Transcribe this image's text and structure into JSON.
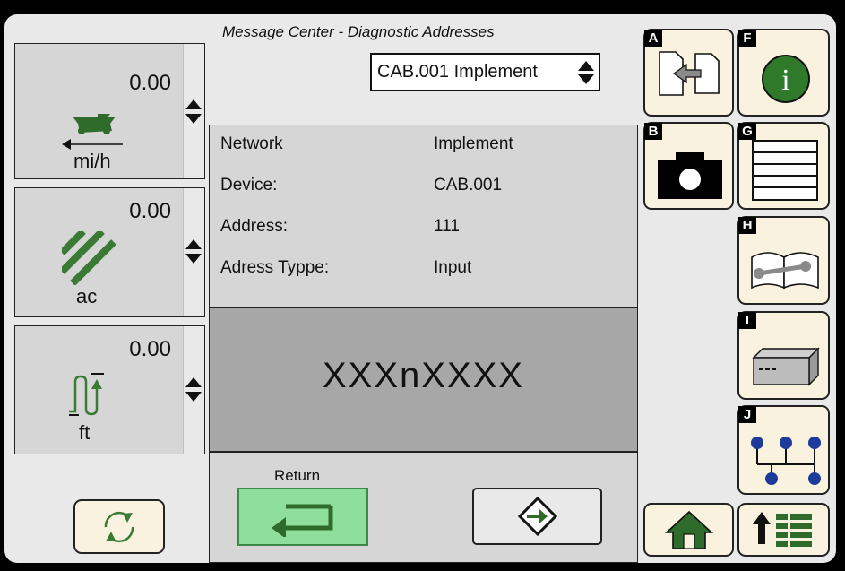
{
  "header": {
    "title": "Message Center - Diagnostic Addresses"
  },
  "device_select": {
    "value": "CAB.001 Implement"
  },
  "gauges": [
    {
      "value": "0.00",
      "unit": "mi/h",
      "icon": "combine-speed-icon"
    },
    {
      "value": "0.00",
      "unit": "ac",
      "icon": "area-hatch-icon"
    },
    {
      "value": "0.00",
      "unit": "ft",
      "icon": "height-arrow-icon"
    }
  ],
  "details": {
    "network_label": "Network",
    "network_value": "Implement",
    "device_label": "Device:",
    "device_value": "CAB.001",
    "address_label": "Address:",
    "address_value": "111",
    "type_label": "Adress Typpe:",
    "type_value": "Input"
  },
  "readout": {
    "value": "XXXnXXXX"
  },
  "footer": {
    "return_label": "Return"
  },
  "softkeys": {
    "a": "A",
    "b": "B",
    "f": "F",
    "g": "G",
    "h": "H",
    "i": "I",
    "j": "J"
  },
  "colors": {
    "screen_bg": "#e9e9e9",
    "panel": "#d6d6d6",
    "readout_bg": "#a7a7a7",
    "button_ivory": "#f9f2de",
    "return_green": "#8fdf9c",
    "icon_green": "#2f6b2a",
    "node_blue": "#1e3a9a"
  }
}
